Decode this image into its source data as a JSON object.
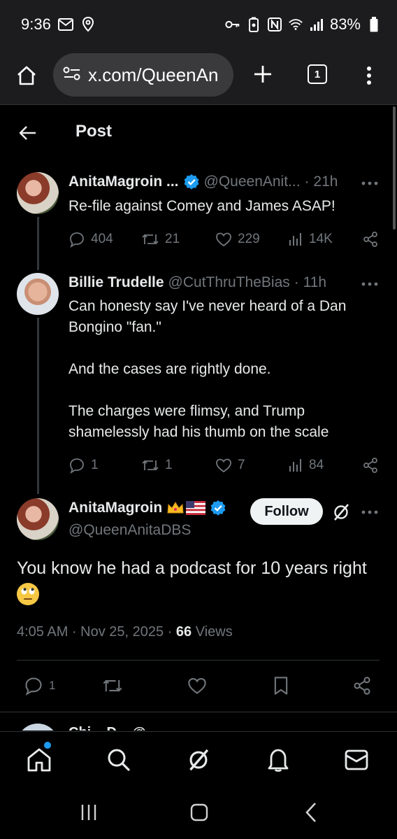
{
  "status_bar": {
    "time": "9:36",
    "battery": "83%",
    "icons": [
      "mail-icon",
      "location-icon",
      "key-icon",
      "lock-battery-icon",
      "nfc-icon",
      "wifi-icon",
      "signal-icon",
      "battery-icon"
    ]
  },
  "browser": {
    "url": "x.com/QueenAn",
    "tab_count": "1"
  },
  "page": {
    "title": "Post"
  },
  "tweets": [
    {
      "name": "AnitaMagroin ...",
      "handle": "@QueenAnit...",
      "time": "· 21h",
      "text": "Re-file against Comey and James ASAP!",
      "replies": "404",
      "retweets": "21",
      "likes": "229",
      "views": "14K"
    },
    {
      "name": "Billie Trudelle",
      "handle": "@CutThruTheBias",
      "time": "· 11h",
      "text": "Can honesty say I've never heard of a Dan\nBongino \"fan.\"\n\nAnd the cases are rightly done.\n\nThe charges were flimsy, and Trump\nshamelessly had his thumb on the scale",
      "replies": "1",
      "retweets": "1",
      "likes": "7",
      "views": "84"
    }
  ],
  "main_post": {
    "name": "AnitaMagroin",
    "handle": "@QueenAnitaDBS",
    "follow_label": "Follow",
    "text": "You know he had a podcast for 10 years right",
    "timestamp": "4:05 AM · Nov 25, 2025 · ",
    "views_count": "66",
    "views_label": "Views",
    "replies": "1"
  },
  "next_reply": {
    "preview": "Chi... D... @..."
  },
  "colors": {
    "background": "#000000",
    "text_primary": "#e7e9ea",
    "text_secondary": "#71767b",
    "verified_blue": "#1d9bf0",
    "divider": "#2f3336"
  }
}
